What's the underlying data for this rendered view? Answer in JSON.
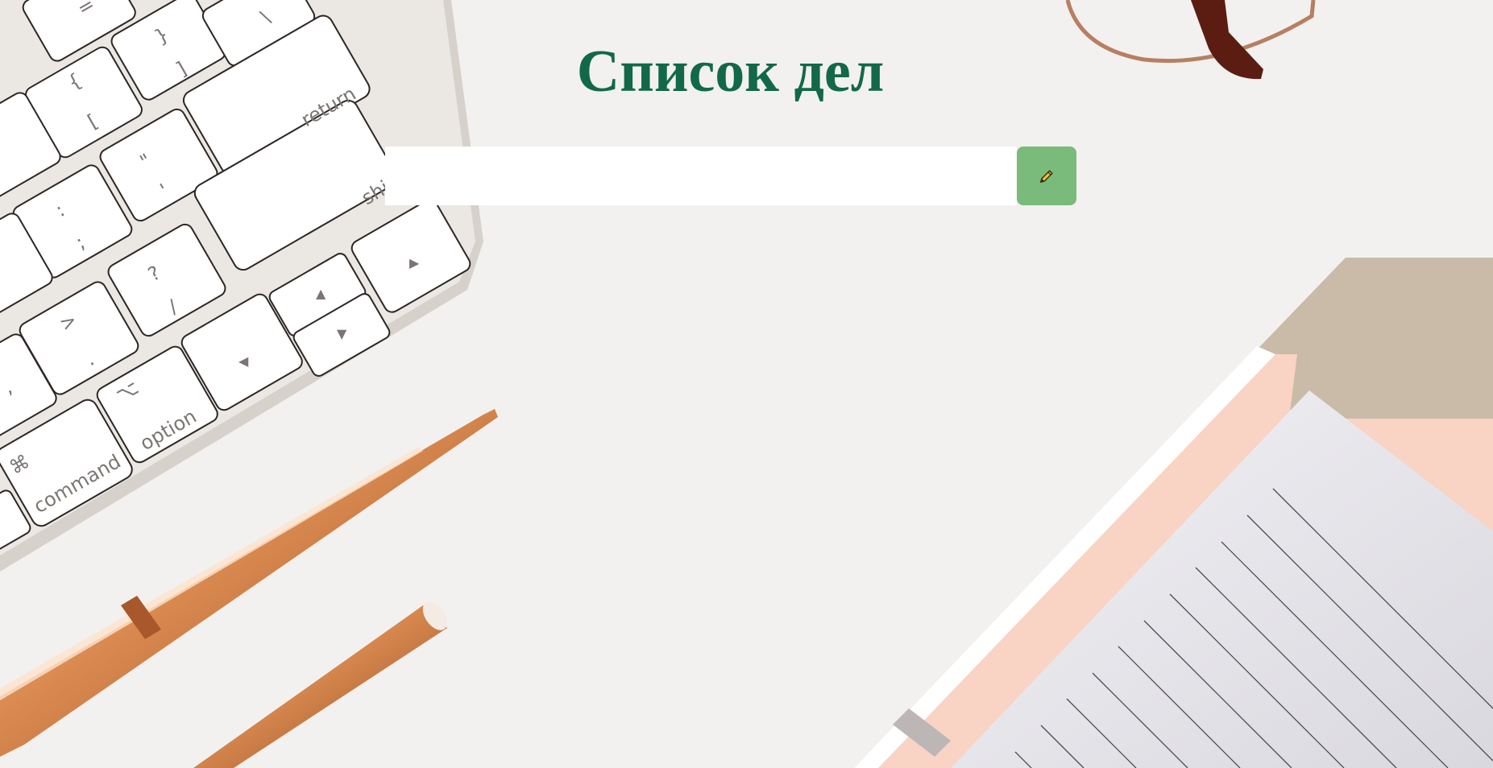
{
  "header": {
    "title": "Список дел"
  },
  "todo_form": {
    "input_value": "",
    "input_placeholder": "",
    "add_button_icon": "pencil-icon"
  },
  "background": {
    "keyboard_keys": [
      "=",
      "}",
      "]",
      "{",
      "[",
      "\\",
      "return",
      "\"",
      "'",
      ":",
      ";",
      "shi",
      "?",
      "/",
      ">",
      ".",
      "▲",
      "▼",
      "◀",
      "▶",
      "⌥",
      "option",
      "⌘",
      "command",
      ","
    ]
  },
  "colors": {
    "title": "#12684a",
    "button": "#7aba7a",
    "icon": "#f2c230",
    "background": "#f2f1ef"
  }
}
